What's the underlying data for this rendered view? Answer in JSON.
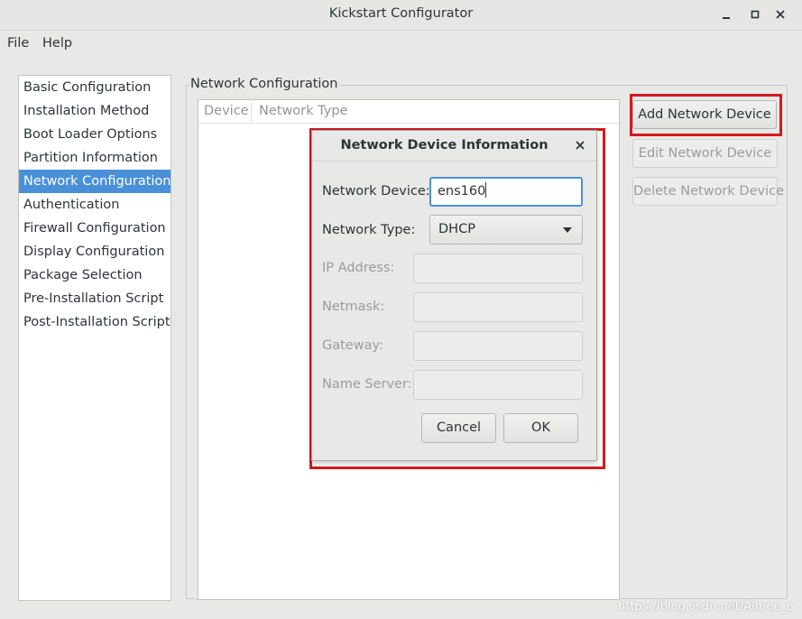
{
  "window": {
    "title": "Kickstart Configurator"
  },
  "menubar": {
    "file": "File",
    "help": "Help"
  },
  "sidebar": {
    "selected_index": 4,
    "items": [
      {
        "label": "Basic Configuration"
      },
      {
        "label": "Installation Method"
      },
      {
        "label": "Boot Loader Options"
      },
      {
        "label": "Partition Information"
      },
      {
        "label": "Network Configuration"
      },
      {
        "label": "Authentication"
      },
      {
        "label": "Firewall Configuration"
      },
      {
        "label": "Display Configuration"
      },
      {
        "label": "Package Selection"
      },
      {
        "label": "Pre-Installation Script"
      },
      {
        "label": "Post-Installation Script"
      }
    ]
  },
  "network": {
    "frame_label": "Network Configuration",
    "columns": [
      "Device",
      "Network Type"
    ],
    "buttons": {
      "add": "Add Network Device",
      "edit": "Edit Network Device",
      "delete": "Delete Network Device"
    }
  },
  "dialog": {
    "title": "Network Device Information",
    "fields": {
      "device_label": "Network Device:",
      "device_value": "ens160",
      "type_label": "Network Type:",
      "type_value": "DHCP",
      "ip_label": "IP Address:",
      "netmask_label": "Netmask:",
      "gateway_label": "Gateway:",
      "nameserver_label": "Name Server:"
    },
    "buttons": {
      "cancel": "Cancel",
      "ok": "OK"
    }
  },
  "watermark": "https://blog.csdn.net/Aimee_c",
  "colors": {
    "accent": "#4a90d9",
    "highlight": "#d41a1f"
  }
}
